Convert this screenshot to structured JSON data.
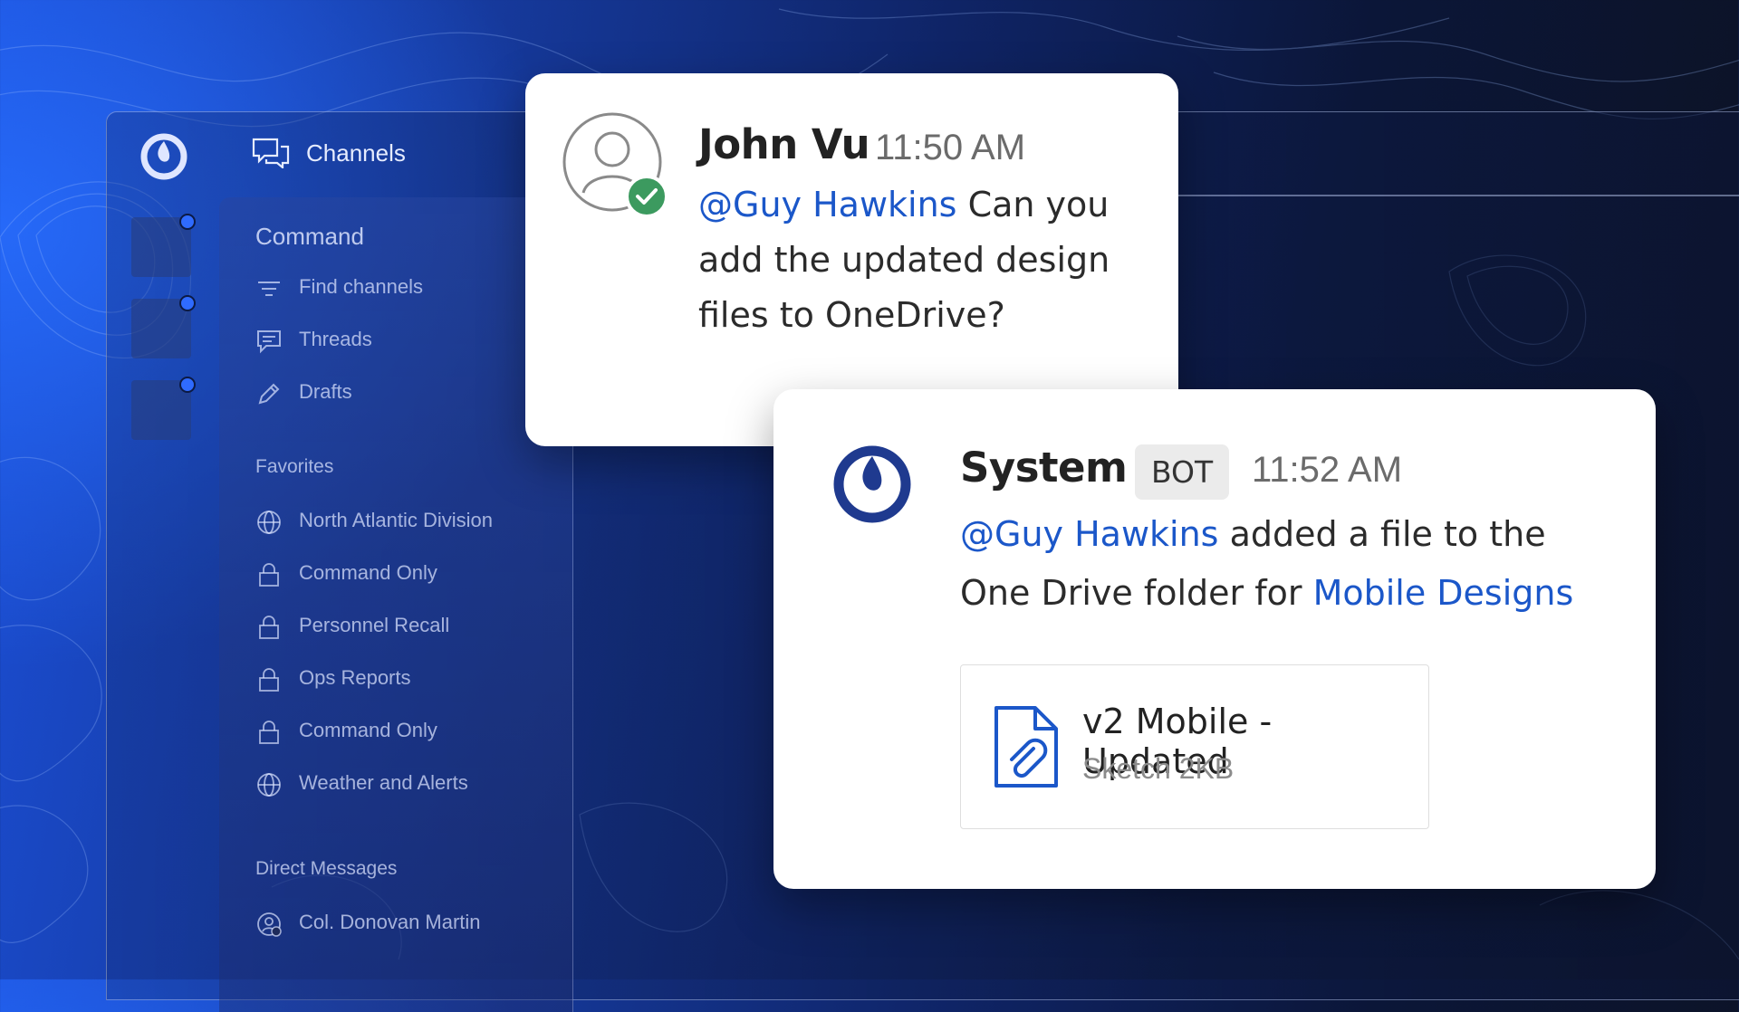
{
  "app": {
    "channels_title": "Channels",
    "team_label": "Command"
  },
  "sidebar": {
    "top_items": [
      {
        "label": "Find channels",
        "icon": "filter-icon"
      },
      {
        "label": "Threads",
        "icon": "threads-icon"
      },
      {
        "label": "Drafts",
        "icon": "pencil-icon"
      }
    ],
    "favorites_heading": "Favorites",
    "favorites": [
      {
        "label": "North Atlantic Division",
        "icon": "globe-icon"
      },
      {
        "label": "Command Only",
        "icon": "lock-icon"
      },
      {
        "label": "Personnel Recall",
        "icon": "lock-icon"
      },
      {
        "label": "Ops Reports",
        "icon": "lock-icon"
      },
      {
        "label": "Command Only",
        "icon": "lock-icon"
      },
      {
        "label": "Weather and Alerts",
        "icon": "globe-icon"
      }
    ],
    "dm_heading": "Direct Messages",
    "dms": [
      {
        "label": "Col. Donovan Martin",
        "icon": "user-status-icon"
      }
    ]
  },
  "message1": {
    "author": "John Vu",
    "time": "11:50 AM",
    "mention": "@Guy Hawkins",
    "text_line1": " Can you",
    "text_line2": "add  the updated design",
    "text_line3": "files to OneDrive?"
  },
  "message2": {
    "author": "System",
    "badge": "BOT",
    "time": "11:52 AM",
    "mention": "@Guy Hawkins",
    "text_line1": " added a file to the",
    "text_line2": "One Drive folder for ",
    "channel_link": "Mobile Designs",
    "file": {
      "name": "v2 Mobile - Updated",
      "meta": "Sketch 2KB"
    }
  },
  "colors": {
    "accent": "#1b57c9",
    "status_online": "#3c9a5f",
    "logo_navy": "#1f3a8f"
  }
}
